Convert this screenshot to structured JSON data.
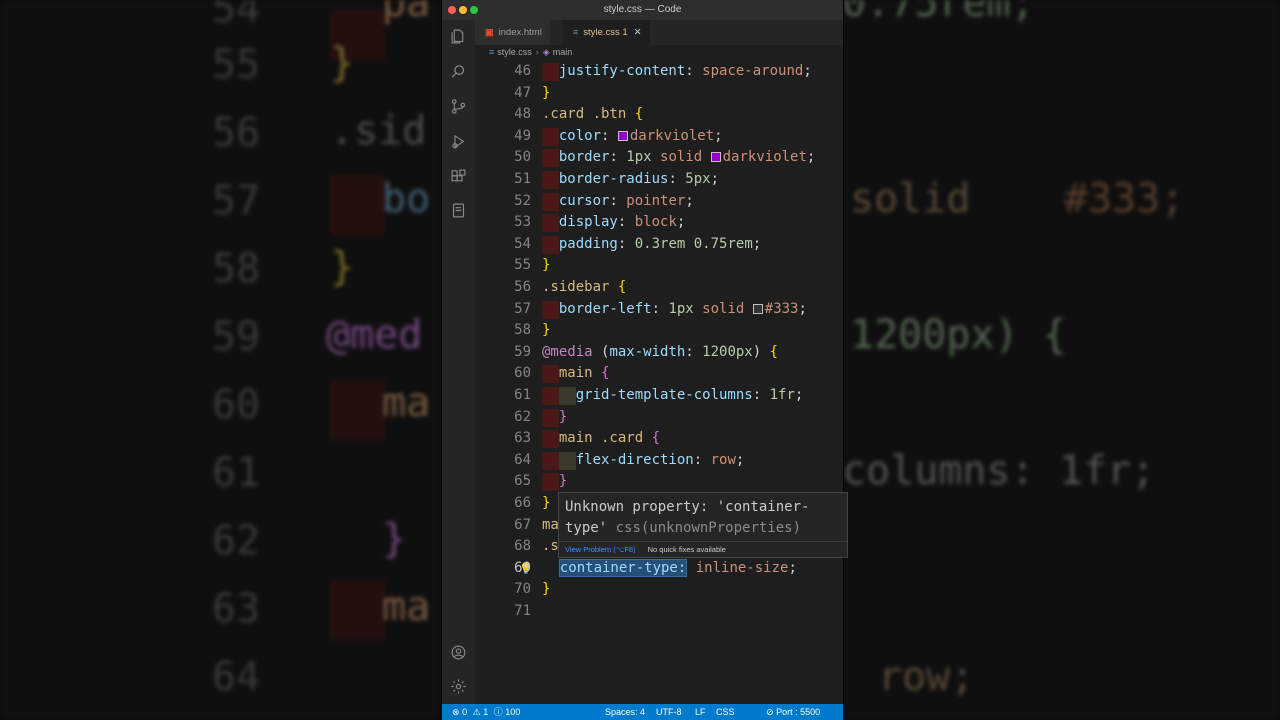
{
  "window": {
    "title": "style.css — Code"
  },
  "tabs": [
    {
      "label": "index.html",
      "icon": "html-file-icon"
    },
    {
      "label": "style.css 1",
      "icon": "css-file-icon"
    }
  ],
  "breadcrumb": {
    "file": "style.css",
    "symbol": "main"
  },
  "editor": {
    "lines": [
      {
        "num": "46",
        "text": "  justify-content: space-around;"
      },
      {
        "num": "47",
        "text": "}"
      },
      {
        "num": "48",
        "text": ".card .btn {"
      },
      {
        "num": "49",
        "text": "  color: darkviolet;"
      },
      {
        "num": "50",
        "text": "  border: 1px solid darkviolet;"
      },
      {
        "num": "51",
        "text": "  border-radius: 5px;"
      },
      {
        "num": "52",
        "text": "  cursor: pointer;"
      },
      {
        "num": "53",
        "text": "  display: block;"
      },
      {
        "num": "54",
        "text": "  padding: 0.3rem 0.75rem;"
      },
      {
        "num": "55",
        "text": "}"
      },
      {
        "num": "56",
        "text": ".sidebar {"
      },
      {
        "num": "57",
        "text": "  border-left: 1px solid #333;"
      },
      {
        "num": "58",
        "text": "}"
      },
      {
        "num": "59",
        "text": "@media (max-width: 1200px) {"
      },
      {
        "num": "60",
        "text": "  main {"
      },
      {
        "num": "61",
        "text": "    grid-template-columns: 1fr;"
      },
      {
        "num": "62",
        "text": "  }"
      },
      {
        "num": "63",
        "text": "  main .card {"
      },
      {
        "num": "64",
        "text": "    flex-direction: row;"
      },
      {
        "num": "65",
        "text": "  }"
      },
      {
        "num": "66",
        "text": "}"
      },
      {
        "num": "67",
        "text": "ma"
      },
      {
        "num": "68",
        "text": ".s"
      },
      {
        "num": "69",
        "text": "  container-type: inline-size;"
      },
      {
        "num": "70",
        "text": "}"
      },
      {
        "num": "71",
        "text": ""
      }
    ],
    "current_line": "69"
  },
  "hover": {
    "message_prop": "Unknown property: 'container-",
    "message_prop2": "type'",
    "source": "css(unknownProperties)",
    "view_problem": "View Problem (⌥F8)",
    "no_fixes": "No quick fixes available"
  },
  "status": {
    "errors": "0",
    "warnings": "1",
    "info": "100",
    "spaces": "Spaces: 4",
    "encoding": "UTF-8",
    "eol": "LF",
    "language": "CSS",
    "port": "Port : 5500"
  },
  "background": {
    "left_nums": [
      "54",
      "55",
      "56",
      "57",
      "58",
      "59",
      "60",
      "61",
      "62",
      "63",
      "64"
    ],
    "right_frags": [
      "0.75rem;",
      "solid",
      "#333;",
      "1200px) {",
      "columns: 1fr;",
      "row;"
    ]
  },
  "colors": {
    "accent": "#007acc",
    "swatch_darkviolet": "#9400d3",
    "swatch_333": "#333333"
  }
}
